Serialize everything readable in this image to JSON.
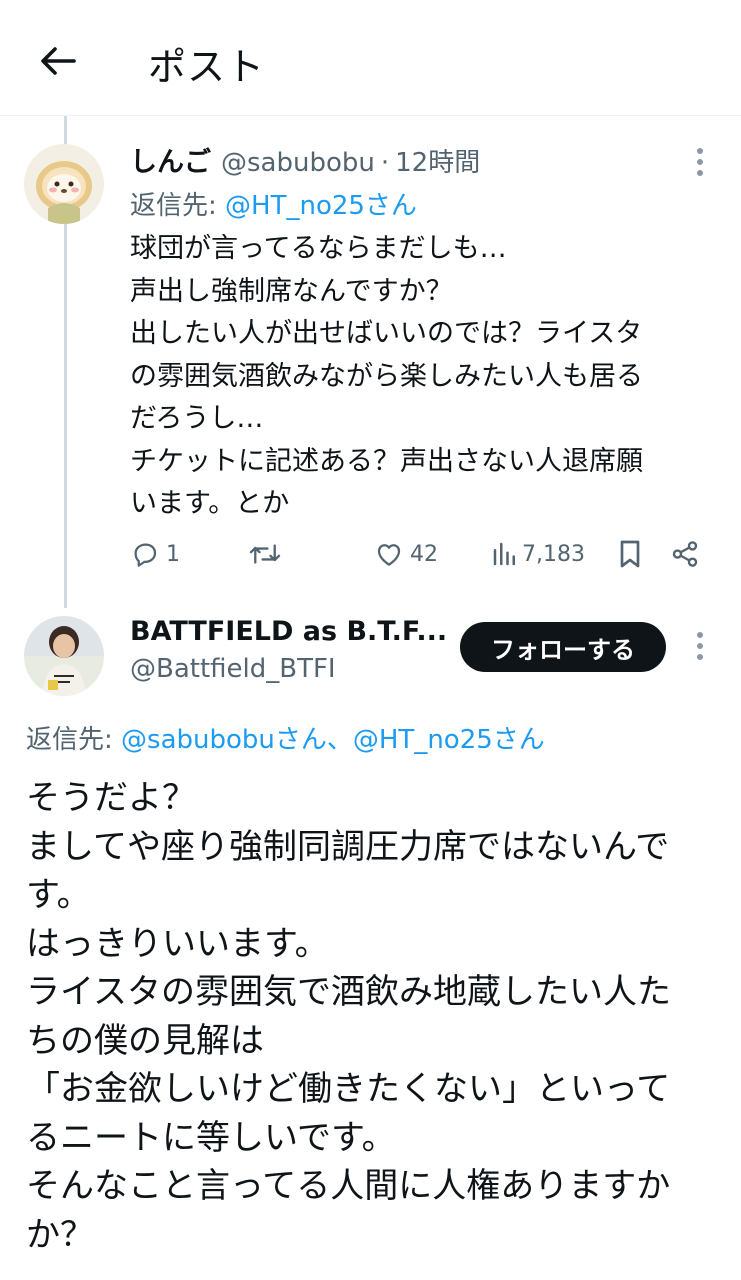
{
  "header": {
    "title": "ポスト"
  },
  "tweet1": {
    "name": "しんご",
    "handle": "@sabubobu",
    "separator": "·",
    "time": "12時間",
    "reply_prefix": "返信先: ",
    "reply_to": "@HT_no25さん",
    "lines": [
      "球団が言ってるならまだしも…",
      "声出し強制席なんですか？",
      "出したい人が出せばいいのでは？ライスタ",
      "の雰囲気酒飲みながら楽しみたい人も居る",
      "だろうし…",
      "チケットに記述ある？声出さない人退席願",
      "います。とか"
    ],
    "actions": {
      "replies": "1",
      "retweets": "",
      "likes": "42",
      "views": "7,183"
    }
  },
  "tweet2": {
    "name": "BATTFIELD as B.T.F...",
    "handle": "@Battfield_BTFI",
    "follow_label": "フォローする",
    "reply_prefix": "返信先: ",
    "reply_to": "@sabubobuさん、@HT_no25さん",
    "lines": [
      "そうだよ？",
      "ましてや座り強制同調圧力席ではないんで",
      "す。",
      "はっきりいいます。",
      "ライスタの雰囲気で酒飲み地蔵したい人た",
      "ちの僕の見解は",
      "「お金欲しいけど働きたくない」といって",
      "るニートに等しいです。",
      "そんなこと言ってる人間に人権ありますか",
      "か？"
    ]
  },
  "colors": {
    "text": "#0f1419",
    "secondary": "#536471",
    "link": "#1d9bf0",
    "follow_bg": "#0f1419"
  },
  "icons": [
    "back-arrow-icon",
    "more-icon",
    "reply-icon",
    "retweet-icon",
    "like-icon",
    "views-icon",
    "bookmark-icon",
    "share-icon"
  ]
}
